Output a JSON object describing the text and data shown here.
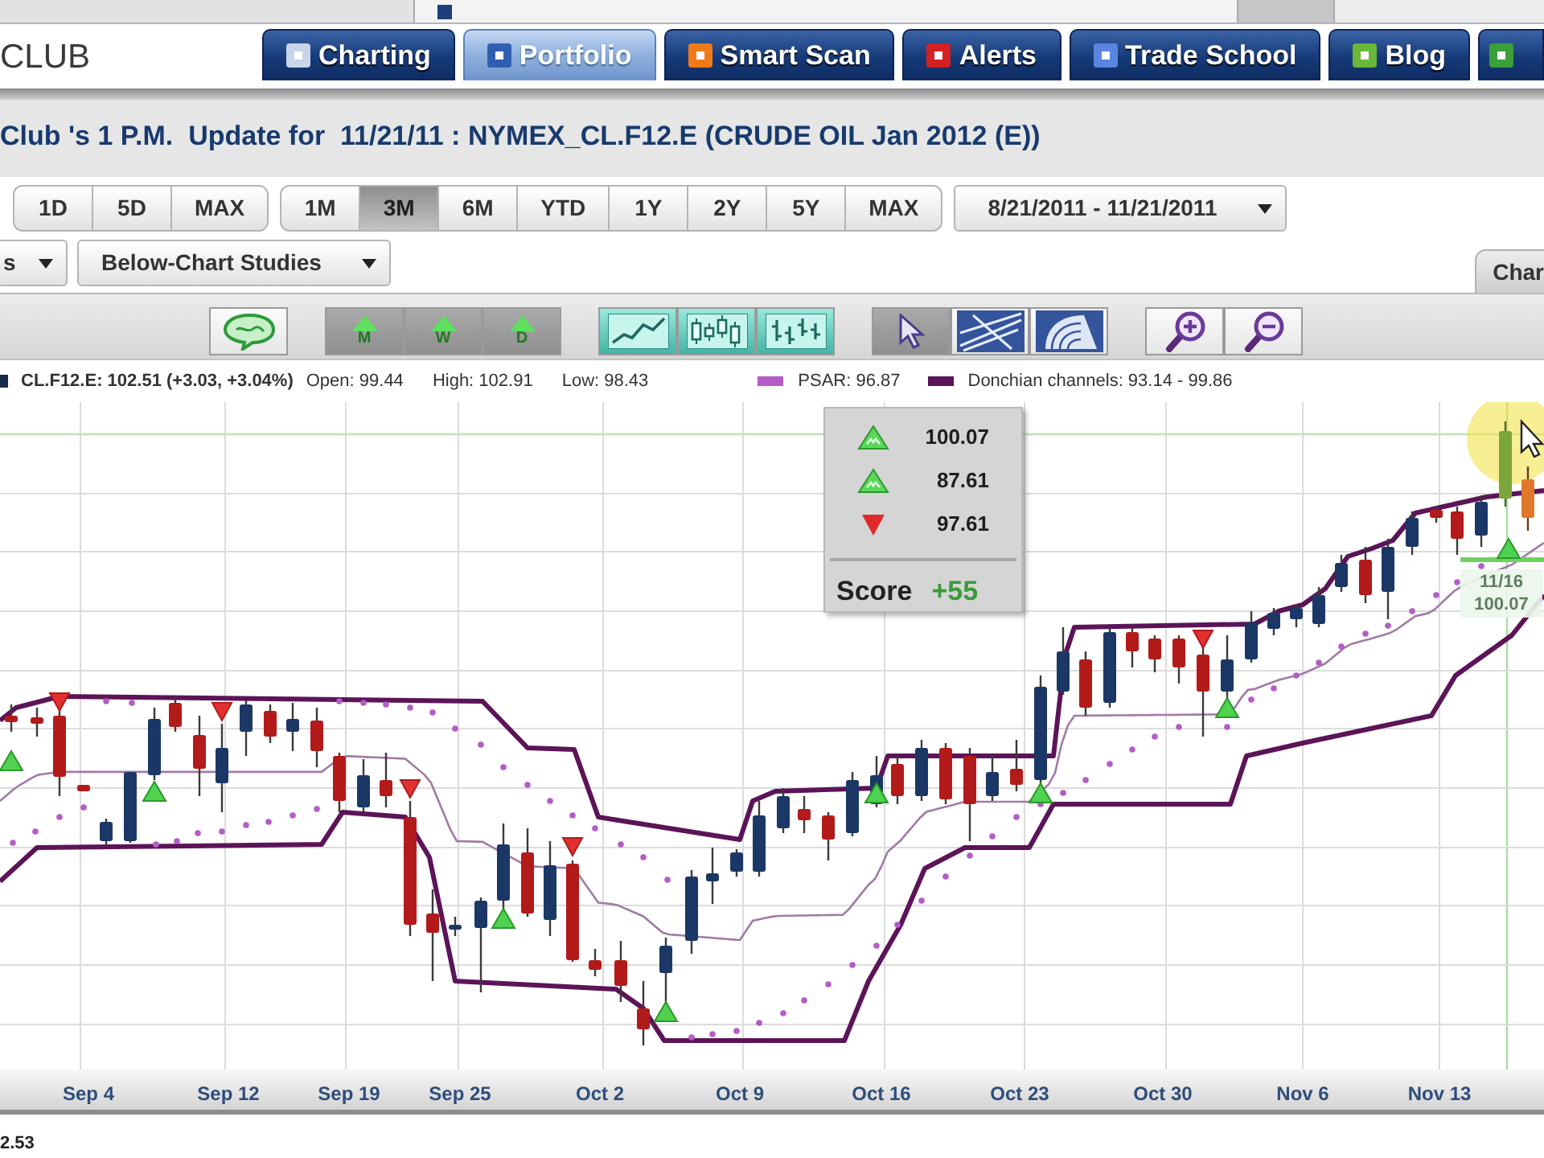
{
  "header": {
    "logo": "CLUB"
  },
  "nav_tabs": [
    {
      "label": "Charting",
      "selected": false,
      "color": "#c8d4e8"
    },
    {
      "label": "Portfolio",
      "selected": true,
      "color": "#2f5fb0"
    },
    {
      "label": "Smart Scan",
      "selected": false,
      "color": "#f07a1a"
    },
    {
      "label": "Alerts",
      "selected": false,
      "color": "#d42020"
    },
    {
      "label": "Trade School",
      "selected": false,
      "color": "#5a86e0"
    },
    {
      "label": "Blog",
      "selected": false,
      "color": "#6ab83a"
    },
    {
      "selected": false,
      "color": "#3aa03a"
    }
  ],
  "title": "Club 's 1 P.M.  Update for  11/21/11 : NYMEX_CL.F12.E (CRUDE OIL Jan 2012 (E))",
  "range_groups": [
    {
      "buttons": [
        {
          "label": "1D",
          "selected": false
        },
        {
          "label": "5D",
          "selected": false
        },
        {
          "label": "MAX",
          "selected": false
        }
      ]
    },
    {
      "buttons": [
        {
          "label": "1M",
          "selected": false
        },
        {
          "label": "3M",
          "selected": true
        },
        {
          "label": "6M",
          "selected": false
        },
        {
          "label": "YTD",
          "selected": false
        },
        {
          "label": "1Y",
          "selected": false
        },
        {
          "label": "2Y",
          "selected": false
        },
        {
          "label": "5Y",
          "selected": false
        },
        {
          "label": "MAX",
          "selected": false
        }
      ]
    }
  ],
  "date_range": {
    "value": "8/21/2011 - 11/21/2011"
  },
  "study_menus": [
    {
      "label": "s"
    },
    {
      "label": "Below-Chart Studies"
    }
  ],
  "side_tab": {
    "label": "Char"
  },
  "toolbar_groups": [
    {
      "tools": [
        {
          "kind": "comment"
        }
      ]
    },
    {
      "tools": [
        {
          "kind": "period",
          "label": "M"
        },
        {
          "kind": "period",
          "label": "W"
        },
        {
          "kind": "period",
          "label": "D"
        }
      ]
    },
    {
      "tools": [
        {
          "kind": "line_chart"
        },
        {
          "kind": "candle_chart"
        },
        {
          "kind": "bar_chart"
        }
      ]
    },
    {
      "tools": [
        {
          "kind": "pointer",
          "selected": true
        },
        {
          "kind": "trend_lines",
          "selected": false
        },
        {
          "kind": "arc_lines",
          "selected": false
        }
      ]
    },
    {
      "tools": [
        {
          "kind": "zoom_in"
        },
        {
          "kind": "zoom_out"
        }
      ]
    }
  ],
  "legend": {
    "quote": "CL.F12.E: 102.51 (+3.03, +3.04%)",
    "stats": [
      "Open: 99.44",
      "High: 102.91",
      "Low: 98.43"
    ],
    "indicators": [
      {
        "label": "PSAR: 96.87",
        "color": "#b45cc8"
      },
      {
        "label": "Donchian channels: 93.14 - 99.86",
        "color": "#5c1458"
      }
    ]
  },
  "score_panel": {
    "signals": [
      {
        "kind": "up",
        "value": "100.07"
      },
      {
        "kind": "up",
        "value": "87.61"
      },
      {
        "kind": "down",
        "value": "97.61"
      }
    ],
    "label": "Score",
    "value": "+55"
  },
  "chart": {
    "callout": {
      "date": "11/16",
      "value": "100.07"
    },
    "x_labels": [
      "Sep 4",
      "Sep 12",
      "Sep 19",
      "Sep 25",
      "Oct 2",
      "Oct 9",
      "Oct 16",
      "Oct 23",
      "Oct 30",
      "Nov 6",
      "Nov 13"
    ]
  },
  "footer": {
    "reading": "2.53"
  }
}
